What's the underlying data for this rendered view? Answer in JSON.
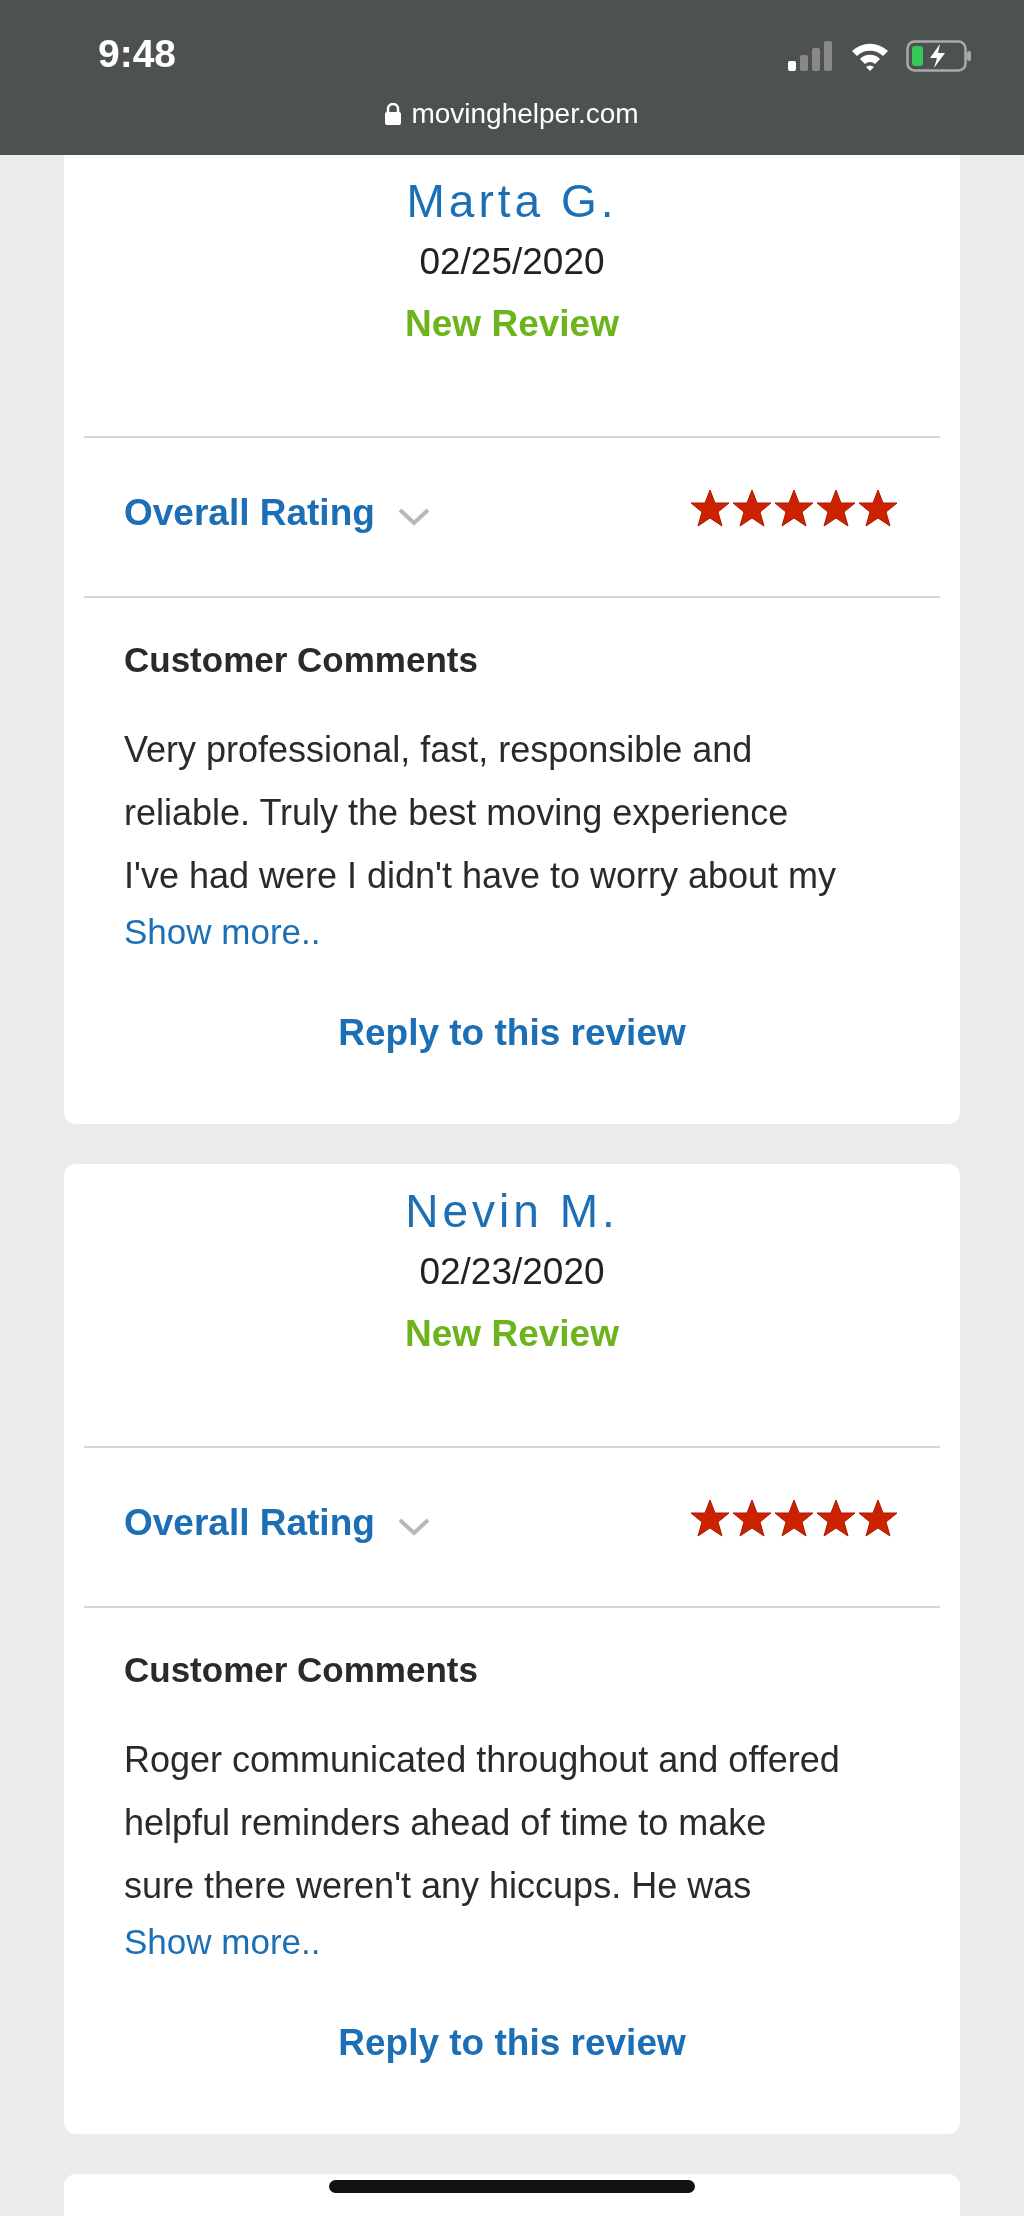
{
  "status_bar": {
    "time": "9:48",
    "url": "movinghelper.com"
  },
  "reviews": [
    {
      "name": "Marta G.",
      "date": "02/25/2020",
      "status": "New Review",
      "rating_label": "Overall Rating",
      "stars": 5,
      "comments_heading": "Customer Comments",
      "comment": "Very professional, fast, responsible and reliable. Truly the best moving experience I've had were I didn't have to worry about my",
      "show_more": "Show more..",
      "reply": "Reply to this review"
    },
    {
      "name": "Nevin M.",
      "date": "02/23/2020",
      "status": "New Review",
      "rating_label": "Overall Rating",
      "stars": 5,
      "comments_heading": "Customer Comments",
      "comment": "Roger communicated throughout and offered helpful reminders ahead of time to make sure there weren't any hiccups. He was",
      "show_more": "Show more..",
      "reply": "Reply to this review"
    }
  ]
}
